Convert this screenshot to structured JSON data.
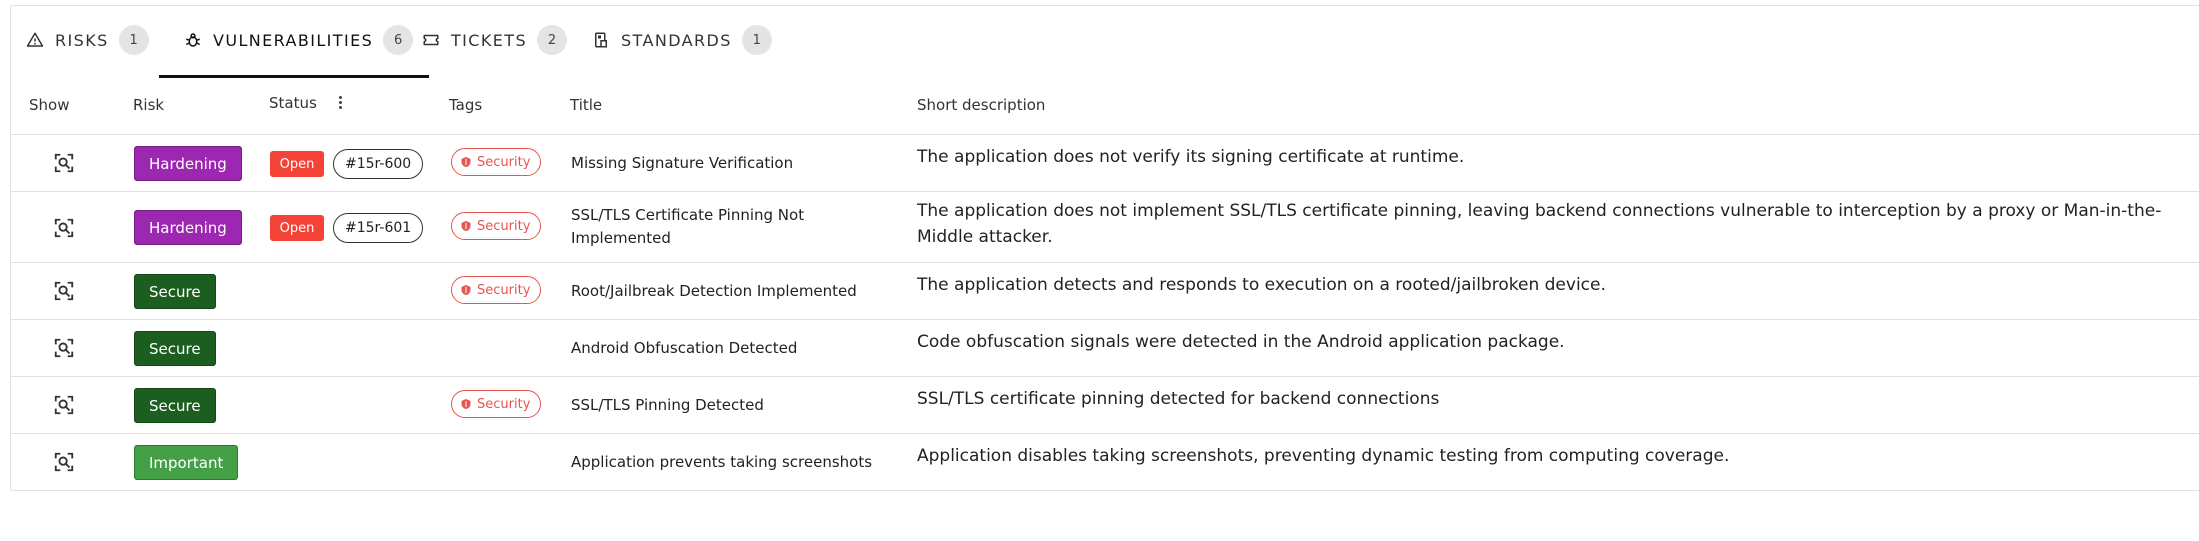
{
  "tabs": [
    {
      "label": "RISKS",
      "count": "1",
      "icon": "warning-icon"
    },
    {
      "label": "VULNERABILITIES",
      "count": "6",
      "icon": "bug-icon"
    },
    {
      "label": "TICKETS",
      "count": "2",
      "icon": "ticket-icon"
    },
    {
      "label": "STANDARDS",
      "count": "1",
      "icon": "standards-icon"
    }
  ],
  "active_tab": "VULNERABILITIES",
  "columns": {
    "show": "Show",
    "risk": "Risk",
    "status": "Status",
    "tags": "Tags",
    "title": "Title",
    "short_description": "Short description"
  },
  "colors": {
    "hardening": "#9c27b0",
    "secure": "#1b5e20",
    "important": "#43a047",
    "open": "#f44336",
    "security_tag": "#e8544e"
  },
  "rows": [
    {
      "risk": "Hardening",
      "status": "Open",
      "ticket": "#15r-600",
      "tag": "Security",
      "title": "Missing Signature Verification",
      "description": "The application does not verify its signing certificate at runtime."
    },
    {
      "risk": "Hardening",
      "status": "Open",
      "ticket": "#15r-601",
      "tag": "Security",
      "title": "SSL/TLS Certificate Pinning Not Implemented",
      "description": "The application does not implement SSL/TLS certificate pinning, leaving backend connections vulnerable to interception by a proxy or Man-in-the-Middle attacker."
    },
    {
      "risk": "Secure",
      "status": "",
      "ticket": "",
      "tag": "Security",
      "title": "Root/Jailbreak Detection Implemented",
      "description": "The application detects and responds to execution on a rooted/jailbroken device."
    },
    {
      "risk": "Secure",
      "status": "",
      "ticket": "",
      "tag": "",
      "title": "Android Obfuscation Detected",
      "description": "Code obfuscation signals were detected in the Android application package."
    },
    {
      "risk": "Secure",
      "status": "",
      "ticket": "",
      "tag": "Security",
      "title": "SSL/TLS Pinning Detected",
      "description": "SSL/TLS certificate pinning detected for backend connections"
    },
    {
      "risk": "Important",
      "status": "",
      "ticket": "",
      "tag": "",
      "title": "Application prevents taking screenshots",
      "description": "Application disables taking screenshots, preventing dynamic testing from computing coverage."
    }
  ]
}
